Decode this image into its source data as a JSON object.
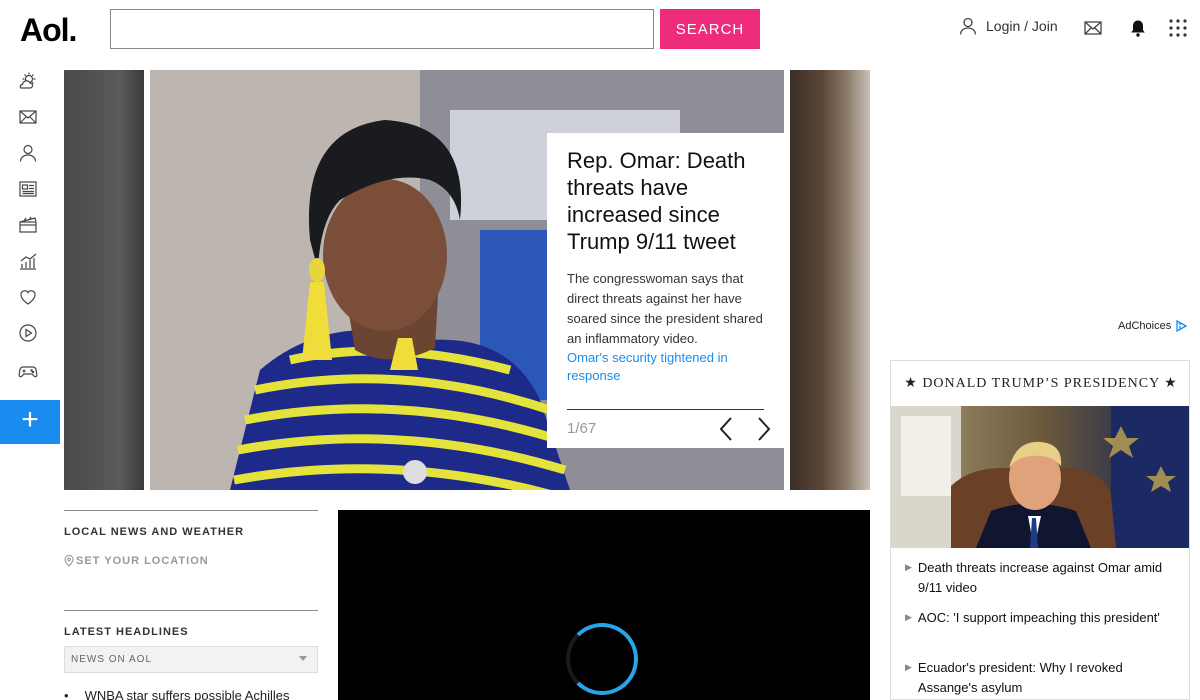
{
  "header": {
    "logo": "Aol.",
    "search_placeholder": "",
    "search_value": "",
    "search_button": "SEARCH",
    "login_label": "Login / Join"
  },
  "left_rail": {
    "icons": [
      "weather-icon",
      "mail-icon",
      "user-icon",
      "news-icon",
      "movies-icon",
      "finance-icon",
      "health-icon",
      "video-icon",
      "games-icon"
    ],
    "add_button": "+"
  },
  "hero": {
    "title": "Rep. Omar: Death threats have increased since Trump 9/11 tweet",
    "description": "The congresswoman says that direct threats against her have soared since the president shared an inflammatory video.",
    "link": "Omar's security tightened in response",
    "counter": "1/67"
  },
  "ad": {
    "adchoices": "AdChoices"
  },
  "panel": {
    "title": "★ DONALD TRUMP’S PRESIDENCY ★",
    "items": [
      {
        "text": "Death threats increase against Omar amid 9/11 video"
      },
      {
        "text": "AOC: 'I support impeaching this president'"
      },
      {
        "text": "Ecuador's president: Why I revoked Assange's asylum"
      }
    ]
  },
  "local": {
    "title": "LOCAL NEWS AND WEATHER",
    "set_location": "SET YOUR LOCATION"
  },
  "latest": {
    "title": "LATEST HEADLINES",
    "selected_source": "NEWS ON AOL",
    "headlines": [
      "WNBA star suffers possible Achilles"
    ]
  },
  "colors": {
    "search_button": "#ee2c7b",
    "accent_blue": "#1a8cf0",
    "link_blue": "#1a8cf0"
  }
}
